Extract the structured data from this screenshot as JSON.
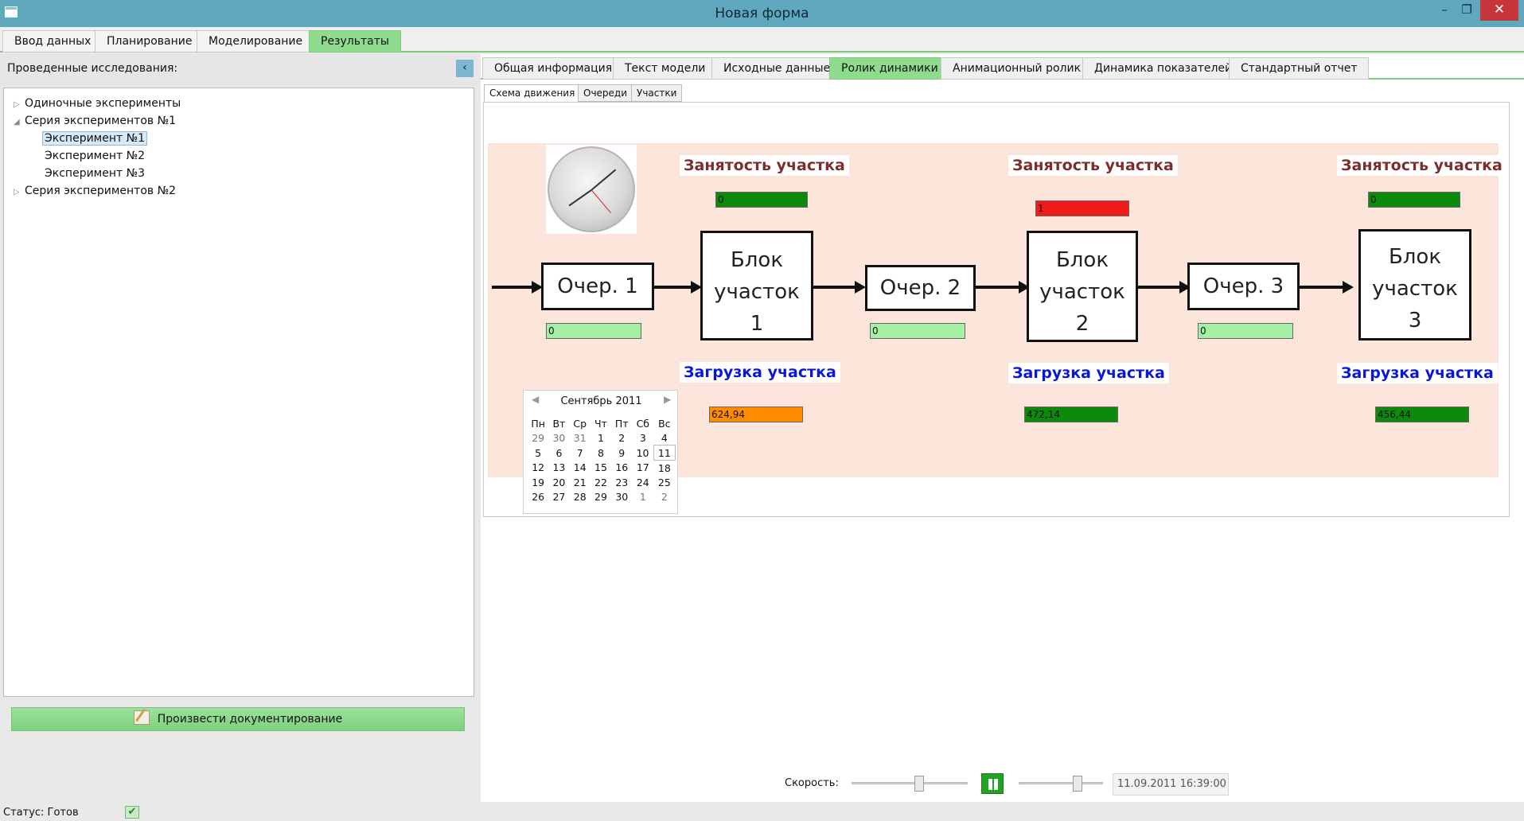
{
  "window": {
    "title": "Новая форма",
    "min_glyph": "–",
    "max_glyph": "❐",
    "close_glyph": "✕"
  },
  "main_tabs": [
    "Ввод данных",
    "Планирование",
    "Моделирование",
    "Результаты"
  ],
  "left_panel": {
    "title": "Проведенные исследования:",
    "collapse_glyph": "‹",
    "tree": [
      {
        "label": "Одиночные эксперименты"
      },
      {
        "label": "Серия экспериментов №1"
      },
      {
        "label": "Эксперимент №1"
      },
      {
        "label": "Эксперимент №2"
      },
      {
        "label": "Эксперимент №3"
      },
      {
        "label": "Серия экспериментов №2"
      }
    ],
    "document_button": "Произвести документирование"
  },
  "result_tabs": [
    "Общая информация",
    "Текст модели",
    "Исходные данные",
    "Ролик динамики",
    "Анимационный ролик",
    "Динамика показателей",
    "Стандартный отчет"
  ],
  "sub_tabs": [
    "Схема движения",
    "Очереди",
    "Участки"
  ],
  "diagram": {
    "queues": [
      {
        "label": "Очер. 1",
        "count": "0"
      },
      {
        "label": "Очер. 2",
        "count": "0"
      },
      {
        "label": "Очер. 3",
        "count": "0"
      }
    ],
    "blocks": [
      {
        "line1": "Блок",
        "line2": "участок",
        "line3": "1",
        "occupancy_label": "Занятость участка",
        "occupancy_value": "0",
        "load_label": "Загрузка участка",
        "load_value": "624,94"
      },
      {
        "line1": "Блок",
        "line2": "участок",
        "line3": "2",
        "occupancy_label": "Занятость участка",
        "occupancy_value": "1",
        "load_label": "Загрузка участка",
        "load_value": "472,14"
      },
      {
        "line1": "Блок",
        "line2": "участок",
        "line3": "3",
        "occupancy_label": "Занятость участка",
        "occupancy_value": "0",
        "load_label": "Загрузка участка",
        "load_value": "456,44"
      }
    ],
    "colors": {
      "busy": "#f01a1a",
      "free": "#0b8a0b",
      "high_load": "#ff8c00",
      "queue": "#a6f0a6"
    }
  },
  "calendar": {
    "month": "Сентябрь 2011",
    "weekdays": [
      "Пн",
      "Вт",
      "Ср",
      "Чт",
      "Пт",
      "Сб",
      "Вс"
    ],
    "weeks": [
      [
        "29",
        "30",
        "31",
        "1",
        "2",
        "3",
        "4"
      ],
      [
        "5",
        "6",
        "7",
        "8",
        "9",
        "10",
        "11"
      ],
      [
        "12",
        "13",
        "14",
        "15",
        "16",
        "17",
        "18"
      ],
      [
        "19",
        "20",
        "21",
        "22",
        "23",
        "24",
        "25"
      ],
      [
        "26",
        "27",
        "28",
        "29",
        "30",
        "1",
        "2"
      ]
    ],
    "selected_day": "11"
  },
  "controls": {
    "speed_label": "Скорость:",
    "datetime": "11.09.2011 16:39:00"
  },
  "status": {
    "text": "Статус: Готов",
    "icon_glyph": "✔"
  }
}
